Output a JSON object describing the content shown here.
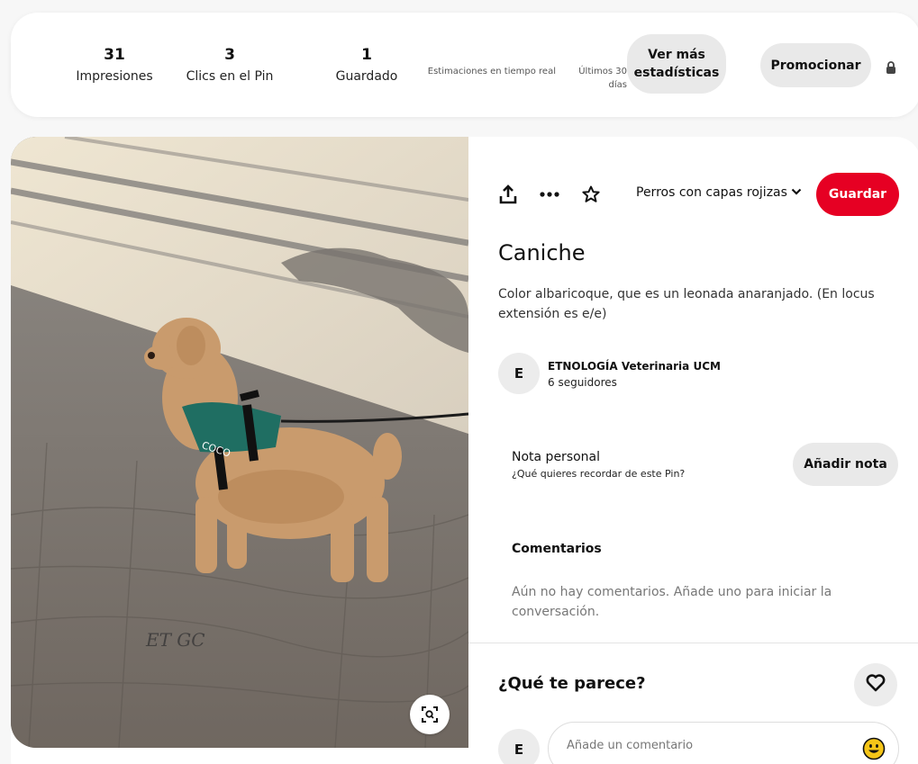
{
  "stats": {
    "impressions": {
      "value": "31",
      "label": "Impresiones"
    },
    "clicks": {
      "value": "3",
      "label": "Clics en el Pin"
    },
    "saves": {
      "value": "1",
      "label": "Guardado"
    },
    "realtime_note": "Estimaciones en tiempo real",
    "period_note": "Últimos 30 días",
    "more_stats_label": "Ver más estadísticas",
    "promote_label": "Promocionar"
  },
  "pin": {
    "board": "Perros con capas rojizas",
    "save_label": "Guardar",
    "title": "Caniche",
    "description": "Color albaricoque, que es un leonada anaranjado. (En locus extensión es e/e)",
    "author": {
      "initial": "E",
      "name": "ETNOLOGÍA Veterinaria UCM",
      "followers": "6 seguidores"
    },
    "image_harness_text": "COCO",
    "image_signature": "ET GC"
  },
  "note": {
    "title": "Nota personal",
    "subtitle": "¿Qué quieres recordar de este Pin?",
    "button_label": "Añadir nota"
  },
  "comments": {
    "title": "Comentarios",
    "empty_text": "Aún no hay comentarios. Añade uno para iniciar la conversación."
  },
  "reaction": {
    "question": "¿Qué te parece?"
  },
  "composer": {
    "user_initial": "E",
    "placeholder": "Añade un comentario"
  },
  "colors": {
    "save_button": "#e60023",
    "pill_bg": "#e9e9e9",
    "emoji": "#f5c518"
  },
  "icons": [
    "lock-icon",
    "share-icon",
    "more-icon",
    "star-icon",
    "chevron-down-icon",
    "visual-search-icon",
    "heart-icon",
    "emoji-icon"
  ]
}
